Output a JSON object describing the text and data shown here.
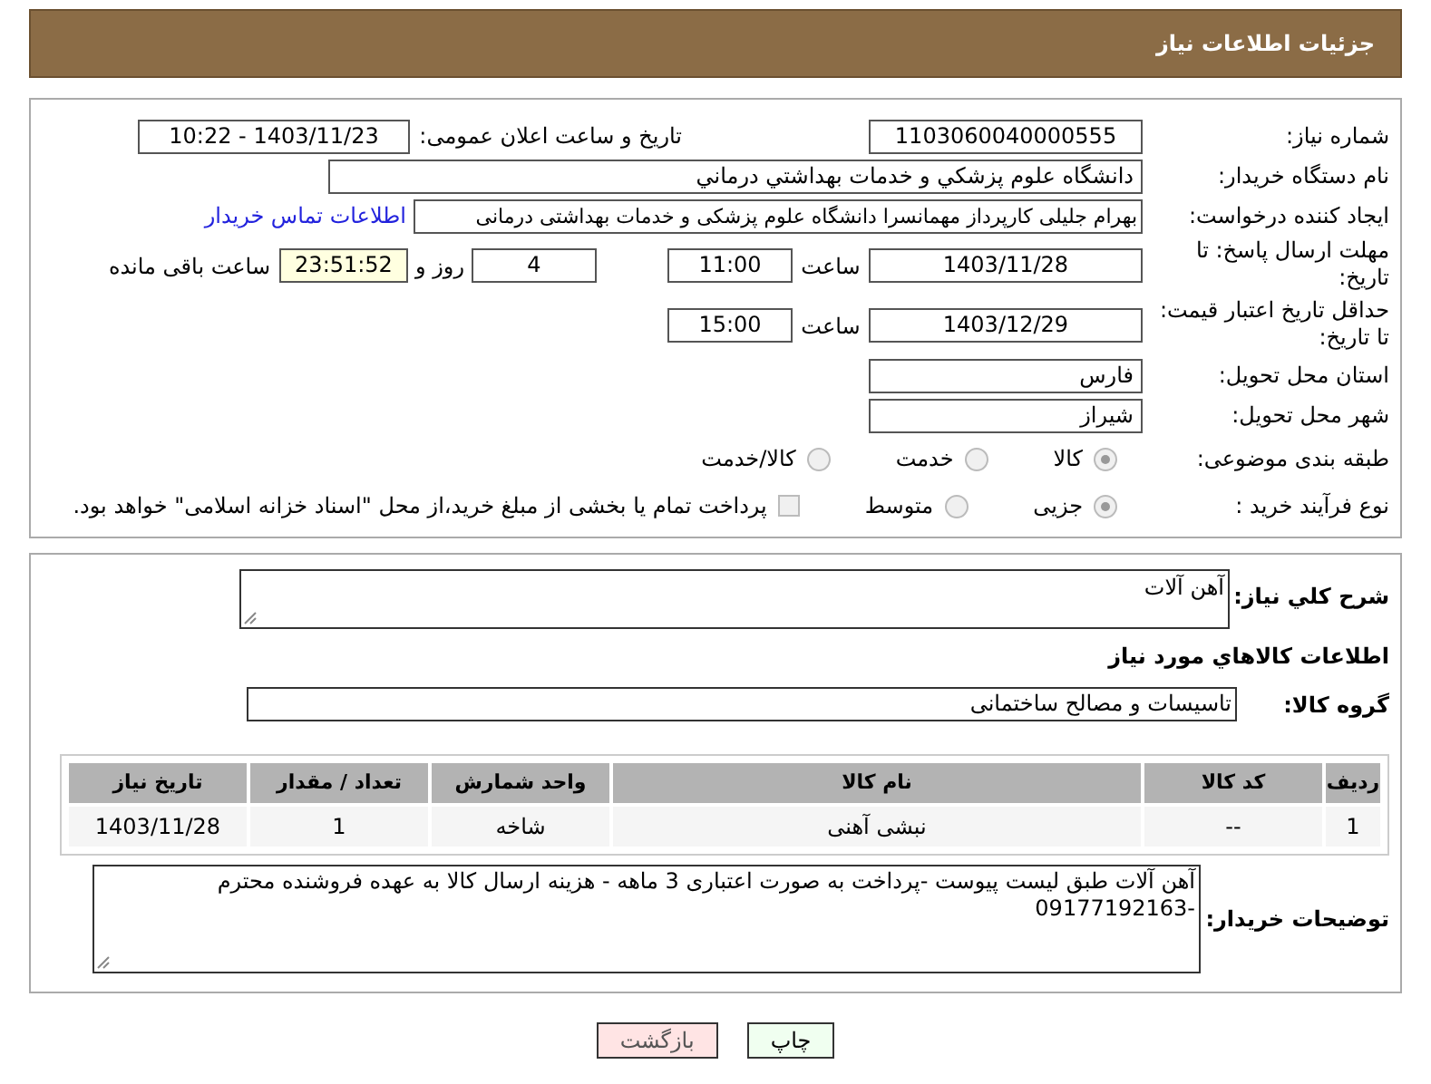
{
  "header": {
    "title": "جزئیات اطلاعات نیاز"
  },
  "need_number": {
    "label": "شماره نیاز:",
    "value": "1103060040000555"
  },
  "announce": {
    "label": "تاریخ و ساعت اعلان عمومی:",
    "value": "1403/11/23 - 10:22"
  },
  "buyer": {
    "label": "نام دستگاه خریدار:",
    "value": "دانشگاه علوم پزشکي و خدمات بهداشتي درماني"
  },
  "creator": {
    "label": "ایجاد کننده درخواست:",
    "value": "بهرام جلیلی کارپرداز مهمانسرا دانشگاه علوم پزشکی و خدمات بهداشتی درمانی",
    "link": "اطلاعات تماس خریدار"
  },
  "deadline": {
    "label": "مهلت ارسال پاسخ: تا تاریخ:",
    "date": "1403/11/28",
    "time_label": "ساعت",
    "time": "11:00",
    "days": "4",
    "days_label": "روز و",
    "remaining": "23:51:52",
    "remaining_label": "ساعت باقی مانده"
  },
  "validity": {
    "label": "حداقل تاریخ اعتبار قیمت: تا تاریخ:",
    "date": "1403/12/29",
    "time_label": "ساعت",
    "time": "15:00"
  },
  "province": {
    "label": "استان محل تحویل:",
    "value": "فارس"
  },
  "city": {
    "label": "شهر محل تحویل:",
    "value": "شیراز"
  },
  "category": {
    "label": "طبقه بندی موضوعی:",
    "options": [
      {
        "label": "کالا",
        "selected": true
      },
      {
        "label": "خدمت",
        "selected": false
      },
      {
        "label": "کالا/خدمت",
        "selected": false
      }
    ]
  },
  "purchase_type": {
    "label": "نوع فرآیند خرید :",
    "options": [
      {
        "label": "جزیی",
        "selected": true
      },
      {
        "label": "متوسط",
        "selected": false
      }
    ],
    "payment": {
      "checked": false,
      "label": "پرداخت تمام یا بخشی از مبلغ خرید،از محل \"اسناد خزانه اسلامی\" خواهد بود."
    }
  },
  "summary": {
    "label": "شرح کلي نياز:",
    "value": "آهن آلات"
  },
  "goods_title": "اطلاعات کالاهاي مورد نياز",
  "goods_group": {
    "label": "گروه کالا:",
    "value": "تاسیسات و مصالح ساختمانی"
  },
  "table": {
    "columns": [
      "ردیف",
      "کد کالا",
      "نام کالا",
      "واحد شمارش",
      "تعداد / مقدار",
      "تاریخ نیاز"
    ],
    "rows": [
      [
        "1",
        "--",
        "نبشی آهنی",
        "شاخه",
        "1",
        "1403/11/28"
      ]
    ]
  },
  "buyer_notes": {
    "label": "توضیحات خریدار:",
    "value": "آهن آلات  طبق لیست پیوست -پرداخت به صورت اعتباری 3 ماهه - هزینه ارسال کالا به عهده فروشنده محترم -09177192163"
  },
  "buttons": [
    {
      "label": "چاپ",
      "kind": "print"
    },
    {
      "label": "بازگشت",
      "kind": "back"
    }
  ]
}
